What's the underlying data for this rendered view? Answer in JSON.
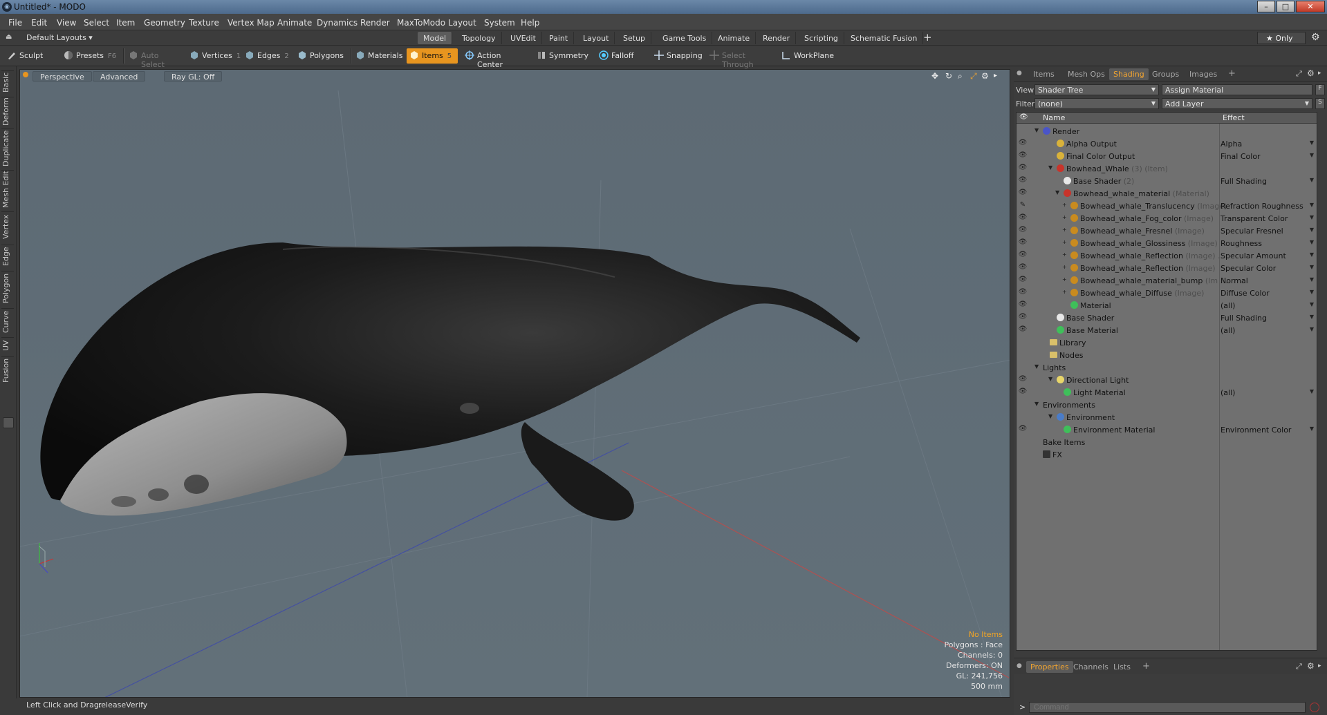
{
  "window": {
    "title": "Untitled* - MODO",
    "buttons": [
      "–",
      "□",
      "✕"
    ]
  },
  "menubar": [
    "File",
    "Edit",
    "View",
    "Select",
    "Item",
    "Geometry",
    "Texture",
    "Vertex Map",
    "Animate",
    "Dynamics",
    "Render",
    "MaxToModo",
    "Layout",
    "System",
    "Help"
  ],
  "layouts": {
    "default_layouts": "Default Layouts ▾",
    "tabs": [
      "Model",
      "Topology",
      "UVEdit",
      "Paint",
      "Layout",
      "Setup",
      "Game Tools",
      "Animate",
      "Render",
      "Scripting",
      "Schematic Fusion"
    ],
    "active_tab": "Model",
    "add": "+",
    "only": "★  Only",
    "gear": "⚙"
  },
  "toolbar": {
    "sculpt": "Sculpt",
    "presets": "Presets",
    "presets_key": "F6",
    "auto_select": "Auto Select",
    "vertices": "Vertices",
    "vertices_key": "1",
    "edges": "Edges",
    "edges_key": "2",
    "polygons": "Polygons",
    "materials": "Materials",
    "items": "Items",
    "items_key": "5",
    "action_center": "Action Center",
    "symmetry": "Symmetry",
    "falloff": "Falloff",
    "snapping": "Snapping",
    "select_through": "Select Through",
    "workplane": "WorkPlane"
  },
  "left_tabs": [
    "Basic",
    "Deform",
    "Duplicate",
    "Mesh Edit",
    "Vertex",
    "Edge",
    "Polygon",
    "Curve",
    "UV",
    "Fusion"
  ],
  "viewport": {
    "perspective": "Perspective",
    "advanced": "Advanced",
    "raygl": "Ray GL: Off",
    "info": {
      "no_items": "No Items",
      "polygons": "Polygons : Face",
      "channels": "Channels: 0",
      "deformers": "Deformers: ON",
      "gl": "GL: 241,756",
      "scale": "500 mm"
    }
  },
  "status": {
    "hint_label": "Left Click and Drag:",
    "hint_value": "releaseVerify"
  },
  "right_panel": {
    "tabs": [
      "Items",
      "Mesh Ops",
      "Shading",
      "Groups",
      "Images"
    ],
    "active_tab": "Shading",
    "add": "+",
    "view_label": "View",
    "view_value": "Shader Tree",
    "assign_material": "Assign Material",
    "f_btn": "F",
    "filter_label": "Filter",
    "filter_value": "(none)",
    "add_layer": "Add Layer",
    "s_btn": "S",
    "tree_header": {
      "name": "Name",
      "effect": "Effect"
    },
    "tree": [
      {
        "name": "Render",
        "sub": "",
        "effect": "",
        "indent": 0,
        "icon": "render",
        "eye": false,
        "exp": "▼"
      },
      {
        "name": "Alpha Output",
        "sub": "",
        "effect": "Alpha",
        "indent": 2,
        "icon": "output",
        "eye": true,
        "exp": ""
      },
      {
        "name": "Final Color Output",
        "sub": "",
        "effect": "Final Color",
        "indent": 2,
        "icon": "output",
        "eye": true,
        "exp": ""
      },
      {
        "name": "Bowhead_Whale",
        "sub": " (3) (Item)",
        "effect": "",
        "indent": 2,
        "icon": "mask",
        "eye": true,
        "exp": "▼"
      },
      {
        "name": "Base Shader",
        "sub": " (2)",
        "effect": "Full Shading",
        "indent": 3,
        "icon": "shader",
        "eye": true,
        "exp": ""
      },
      {
        "name": "Bowhead_whale_material",
        "sub": " (Material)",
        "effect": "",
        "indent": 3,
        "icon": "mask",
        "eye": true,
        "exp": "▼"
      },
      {
        "name": "Bowhead_whale_Translucency",
        "sub": " (Image)",
        "effect": "Refraction Roughness",
        "indent": 4,
        "icon": "image",
        "eye": "brush",
        "exp": "+"
      },
      {
        "name": "Bowhead_whale_Fog_color",
        "sub": " (Image)",
        "effect": "Transparent Color",
        "indent": 4,
        "icon": "image",
        "eye": true,
        "exp": "+"
      },
      {
        "name": "Bowhead_whale_Fresnel",
        "sub": " (Image)",
        "effect": "Specular Fresnel",
        "indent": 4,
        "icon": "image",
        "eye": true,
        "exp": "+"
      },
      {
        "name": "Bowhead_whale_Glossiness",
        "sub": " (Image)",
        "effect": "Roughness",
        "indent": 4,
        "icon": "image",
        "eye": true,
        "exp": "+"
      },
      {
        "name": "Bowhead_whale_Reflection",
        "sub": " (Image) ...",
        "effect": "Specular Amount",
        "indent": 4,
        "icon": "image",
        "eye": true,
        "exp": "+"
      },
      {
        "name": "Bowhead_whale_Reflection",
        "sub": " (Image)",
        "effect": "Specular Color",
        "indent": 4,
        "icon": "image",
        "eye": true,
        "exp": "+"
      },
      {
        "name": "Bowhead_whale_material_bump",
        "sub": " (Im ...",
        "effect": "Normal",
        "indent": 4,
        "icon": "image",
        "eye": true,
        "exp": "+"
      },
      {
        "name": "Bowhead_whale_Diffuse",
        "sub": " (Image)",
        "effect": "Diffuse Color",
        "indent": 4,
        "icon": "image",
        "eye": true,
        "exp": "+"
      },
      {
        "name": "Material",
        "sub": "",
        "effect": "(all)",
        "indent": 4,
        "icon": "material",
        "eye": true,
        "exp": ""
      },
      {
        "name": "Base Shader",
        "sub": "",
        "effect": "Full Shading",
        "indent": 2,
        "icon": "shader",
        "eye": true,
        "exp": ""
      },
      {
        "name": "Base Material",
        "sub": "",
        "effect": "(all)",
        "indent": 2,
        "icon": "material",
        "eye": true,
        "exp": ""
      },
      {
        "name": "Library",
        "sub": "",
        "effect": "",
        "indent": 1,
        "icon": "folder",
        "eye": false,
        "exp": ""
      },
      {
        "name": "Nodes",
        "sub": "",
        "effect": "",
        "indent": 1,
        "icon": "folder",
        "eye": false,
        "exp": ""
      },
      {
        "name": "Lights",
        "sub": "",
        "effect": "",
        "indent": 0,
        "icon": "none",
        "eye": false,
        "exp": "▼"
      },
      {
        "name": "Directional Light",
        "sub": "",
        "effect": "",
        "indent": 2,
        "icon": "light",
        "eye": true,
        "exp": "▼"
      },
      {
        "name": "Light Material",
        "sub": "",
        "effect": "(all)",
        "indent": 3,
        "icon": "material",
        "eye": true,
        "exp": ""
      },
      {
        "name": "Environments",
        "sub": "",
        "effect": "",
        "indent": 0,
        "icon": "none",
        "eye": false,
        "exp": "▼"
      },
      {
        "name": "Environment",
        "sub": "",
        "effect": "",
        "indent": 2,
        "icon": "env",
        "eye": false,
        "exp": "▼"
      },
      {
        "name": "Environment Material",
        "sub": "",
        "effect": "Environment Color",
        "indent": 3,
        "icon": "material",
        "eye": true,
        "exp": ""
      },
      {
        "name": "Bake Items",
        "sub": "",
        "effect": "",
        "indent": 0,
        "icon": "none",
        "eye": false,
        "exp": ""
      },
      {
        "name": "FX",
        "sub": "",
        "effect": "",
        "indent": 0,
        "icon": "fx",
        "eye": false,
        "exp": ""
      }
    ],
    "bottom_tabs": [
      "Properties",
      "Channels",
      "Lists"
    ],
    "bottom_active": "Properties",
    "command_prompt": ">",
    "command_placeholder": "Command"
  }
}
